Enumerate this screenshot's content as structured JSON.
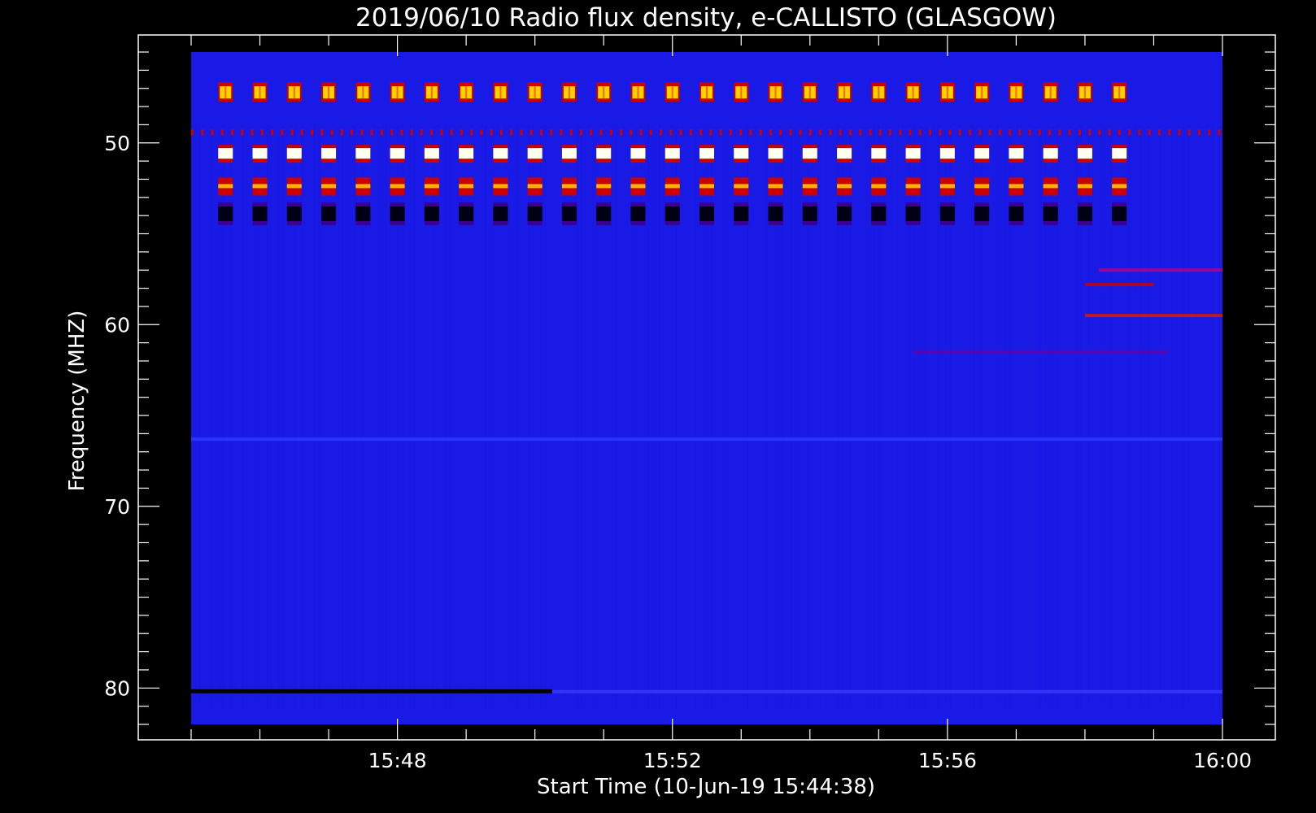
{
  "chart_data": {
    "type": "heatmap",
    "title": "2019/06/10  Radio flux density, e-CALLISTO (GLASGOW)",
    "xlabel": "Start Time (10-Jun-19 15:44:38)",
    "ylabel": "Frequency (MHZ)",
    "x_range": [
      "15:45:00",
      "16:00:00"
    ],
    "y_range_mhz": [
      45,
      82
    ],
    "y_inverted": true,
    "x_tick_labels": [
      "15:48",
      "15:52",
      "15:56",
      "16:00"
    ],
    "x_tick_minutes": [
      3,
      7,
      11,
      15
    ],
    "y_ticks": [
      50,
      60,
      70,
      80
    ],
    "background_color": "#1a1ae6",
    "colormap": [
      "#000000",
      "#1a1ae6",
      "#cc0000",
      "#ff6600",
      "#ffd200",
      "#ffffee"
    ],
    "periodic_bursts": {
      "count": 27,
      "start_minute": 0.5,
      "period_minutes": 0.5,
      "bands_mhz": [
        {
          "freq": 47.2,
          "level": "yellow"
        },
        {
          "freq": 50.6,
          "level": "white"
        },
        {
          "freq": 52.4,
          "level": "orange"
        },
        {
          "freq": 53.9,
          "level": "dark"
        }
      ]
    },
    "emission_features": [
      {
        "type": "spike-line",
        "freq": 49.4,
        "from_minute": 0,
        "to_minute": 15,
        "color": "#cc0000"
      },
      {
        "type": "band",
        "freq": 57.0,
        "from_minute": 13.2,
        "to_minute": 15,
        "color": "#b3008c"
      },
      {
        "type": "band",
        "freq": 57.8,
        "from_minute": 13.0,
        "to_minute": 14.0,
        "color": "#cc0000"
      },
      {
        "type": "band",
        "freq": 59.5,
        "from_minute": 13.0,
        "to_minute": 15,
        "color": "#d91a00"
      },
      {
        "type": "band",
        "freq": 61.5,
        "from_minute": 10.5,
        "to_minute": 14.2,
        "color": "#6600aa"
      },
      {
        "type": "band",
        "freq": 66.3,
        "from_minute": 0,
        "to_minute": 15,
        "color": "#2a3cff"
      },
      {
        "type": "band",
        "freq": 80.2,
        "from_minute": 0,
        "to_minute": 15,
        "color": "#3a3aff"
      }
    ],
    "data_gaps": [
      {
        "freq": 80.2,
        "from_minute": 0,
        "to_minute": 5.25
      }
    ]
  }
}
